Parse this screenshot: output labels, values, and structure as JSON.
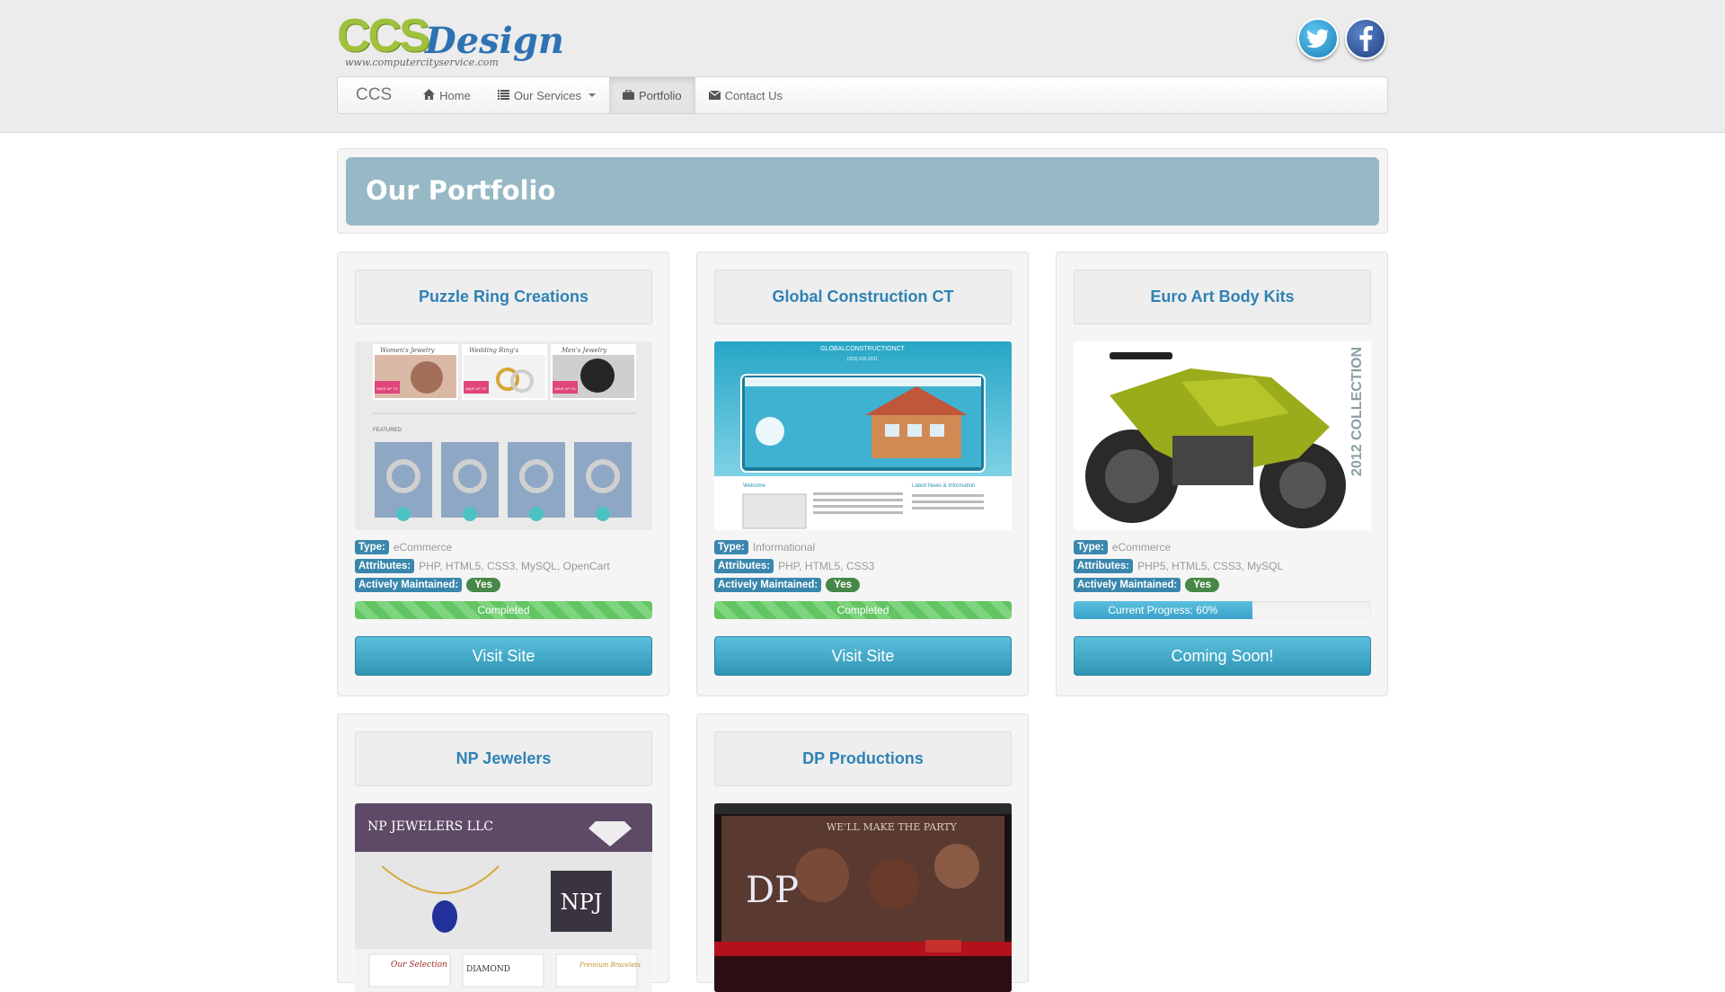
{
  "header": {
    "logo_main": "CCS",
    "logo_design": "Design",
    "logo_url": "www.computercityservice.com"
  },
  "social": [
    {
      "name": "twitter",
      "icon": "twitter-icon"
    },
    {
      "name": "facebook",
      "icon": "facebook-icon"
    }
  ],
  "nav": {
    "brand": "CCS",
    "items": [
      {
        "label": "Home",
        "icon": "home-icon"
      },
      {
        "label": "Our Services",
        "icon": "list-icon",
        "dropdown": true
      },
      {
        "label": "Portfolio",
        "icon": "briefcase-icon",
        "active": true
      },
      {
        "label": "Contact Us",
        "icon": "envelope-icon"
      }
    ]
  },
  "hero": {
    "title": "Our Portfolio"
  },
  "labels": {
    "type": "Type:",
    "attributes": "Attributes:",
    "maintained": "Actively Maintained:"
  },
  "projects": [
    {
      "title": "Puzzle Ring Creations",
      "type": "eCommerce",
      "attributes": "PHP, HTML5, CSS3, MySQL, OpenCart",
      "maintained": "Yes",
      "progress_text": "Completed",
      "progress_fraction": 1.0,
      "button": "Visit Site"
    },
    {
      "title": "Global Construction CT",
      "type": "Informational",
      "attributes": "PHP, HTML5, CSS3",
      "maintained": "Yes",
      "progress_text": "Completed",
      "progress_fraction": 1.0,
      "button": "Visit Site"
    },
    {
      "title": "Euro Art Body Kits",
      "type": "eCommerce",
      "attributes": "PHP5, HTML5, CSS3, MySQL",
      "maintained": "Yes",
      "progress_text": "Current Progress: 60%",
      "progress_fraction": 0.6,
      "button": "Coming Soon!"
    },
    {
      "title": "NP Jewelers"
    },
    {
      "title": "DP Productions"
    }
  ],
  "thumbnails": {
    "puzzle": {
      "cats": [
        "Women's Jewelry",
        "Wedding Ring's",
        "Men's Jewelry"
      ],
      "featured": "FEATURED",
      "promo": "SAVE UP TO"
    },
    "global": {
      "brand": "GLOBALCONSTRUCTIONCT",
      "phone": "(203) 203-2031",
      "welcome": "Welcome",
      "news": "Latest News & Information"
    },
    "euro": {
      "collection": "2012 COLLECTION"
    },
    "np": {
      "brand": "NP JEWELERS LLC",
      "mono": "NPJ",
      "tile1": "Our Selection",
      "tile2": "DIAMOND",
      "tile3": "Premium Bracelets"
    },
    "dp": {
      "tagline": "WE'LL MAKE THE PARTY",
      "mono": "DP"
    }
  },
  "colors": {
    "accent": "#2f82b5",
    "hero": "#97b8c5",
    "label": "#3a87ad",
    "badge": "#468847",
    "progress_green": "#62c462",
    "button": "#2f96b4"
  }
}
